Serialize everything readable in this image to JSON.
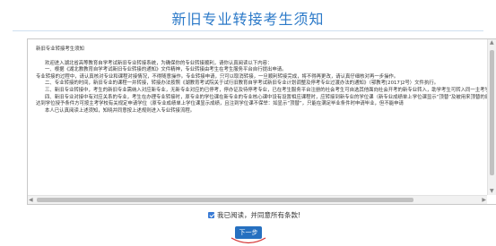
{
  "page": {
    "title": "新旧专业转接考生须知"
  },
  "notice": {
    "heading": "新旧专业转接考生须知",
    "paragraphs": [
      "欢迎进入湖北省高等教育自学考试新旧专业转接系统，为确保你的专业转接顺利，请你认真阅读以下内容：",
      "一、根据《湖北教教育自学考试新旧专业转接的通知》文件精神，专业转接由考生在考生服务平台自行提出申请。",
      "专业转接的过程中，请认真核对专业和课程对接情况，不得随意操作。专业转接申请，只可以取消转接，一旦顺利转接完成，将不得再更改，请认真仔细核对再一步操作。",
      "二、专业转接的时间，新旧专业的课程一并转接，转接办法按照《湖教育考试院关于试行旧教育自学考试新旧专业计划调整及停考专业过渡办法的通知》（鄂教考[2017]2号）文件执行。",
      "三、新旧专业转接中，考生的新旧专业需纳入对应新专业，无新专业对应的已停考，停办证及待停考专业，已在考生服务平台注册的社会考生可自选其他面向社会开考的新专业转入，助学考生可转入同一主考学校、同一助学机构下已开设的新专业。",
      "四、新旧专业对接中有对应关系的专业，考生在办理专业转接时，原专业的学位课在新专业的专业核心课中设有设置相应课程时，应转接到新专业的学位课（新专业成绩单上学位课显示“顶替”及被用来顶替的原学位课课程代码和成绩），原专业的学位课成绩提供主考学校该类学位审核和参考（考生提供成绩单）；如原专业学位课已设置为新专业核心课的非学位课，转接到新专业后，新专业的学位课也重新报考",
      "达到学位授予条件方可按主考学校有关规定申请学位（原专业成绩单上学位课显示成绩，且注到学位课不保举：如显示“顶替”，只能在满足毕业条件时申请毕业，但不能申请",
      "本人已认真阅读上述须知，知晓并同意按上述规则进入专业转接流程。"
    ]
  },
  "agree": {
    "label": "我已阅读，并同意所有条款!",
    "checked": true
  },
  "next_button": {
    "label": "下一步"
  },
  "colors": {
    "title": "#2b79c8",
    "button": "#2670c0",
    "annotation": "#d43030"
  }
}
